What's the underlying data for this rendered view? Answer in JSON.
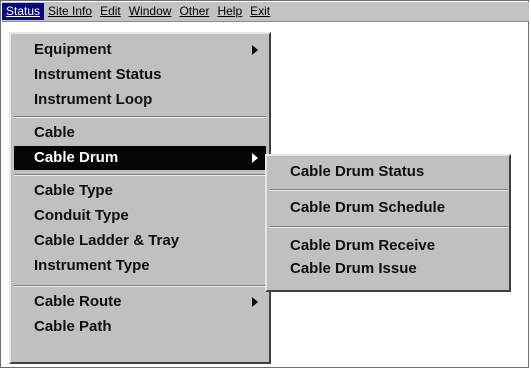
{
  "menubar": {
    "items": [
      {
        "label": "Status"
      },
      {
        "label": "Site Info"
      },
      {
        "label": "Edit"
      },
      {
        "label": "Window"
      },
      {
        "label": "Other"
      },
      {
        "label": "Help"
      },
      {
        "label": "Exit"
      }
    ]
  },
  "status_menu": {
    "items": [
      {
        "label": "Equipment"
      },
      {
        "label": "Instrument Status"
      },
      {
        "label": "Instrument Loop"
      },
      {
        "label": "Cable"
      },
      {
        "label": "Cable Drum"
      },
      {
        "label": "Cable Type"
      },
      {
        "label": "Conduit Type"
      },
      {
        "label": "Cable Ladder & Tray"
      },
      {
        "label": "Instrument Type"
      },
      {
        "label": "Cable Route"
      },
      {
        "label": "Cable Path"
      }
    ]
  },
  "cable_drum_submenu": {
    "items": [
      {
        "label": "Cable Drum Status"
      },
      {
        "label": "Cable Drum Schedule"
      },
      {
        "label": "Cable Drum Receive"
      },
      {
        "label": "Cable Drum Issue"
      }
    ]
  },
  "colors": {
    "menu_background": "#c0c0c0",
    "selection_background": "#050505",
    "active_menubar_item": "#0a0a7a"
  },
  "icons": {
    "submenu_arrow": "submenu-arrow-icon"
  }
}
